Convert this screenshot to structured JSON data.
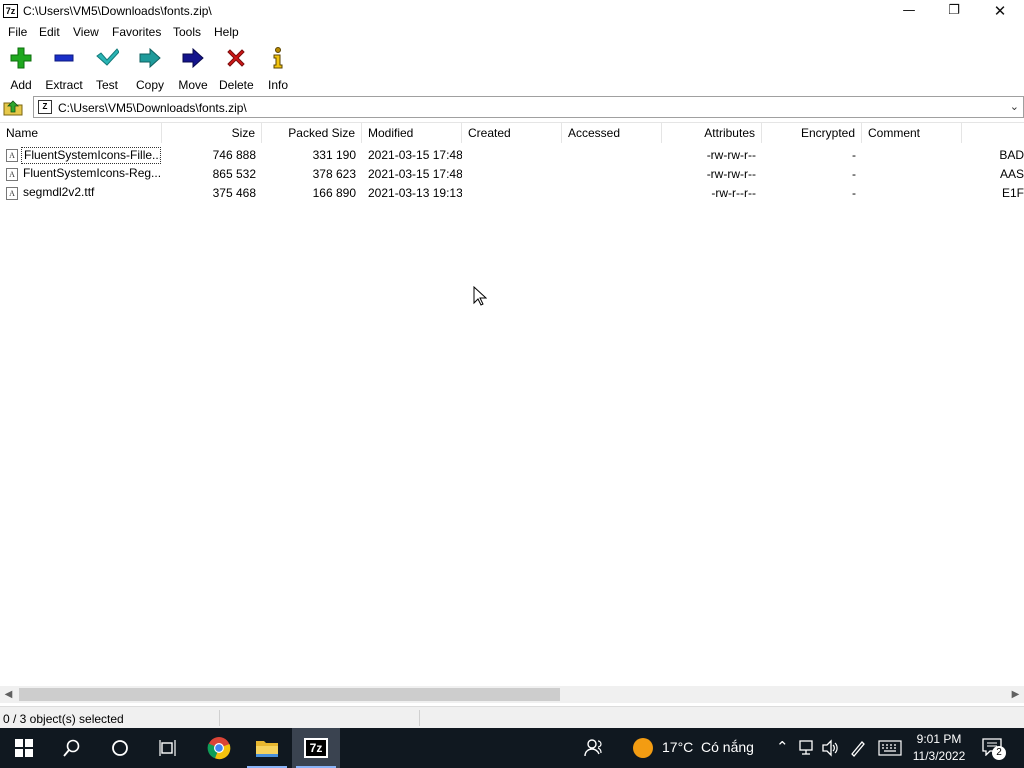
{
  "window": {
    "app_icon_text": "7z",
    "title": "C:\\Users\\VM5\\Downloads\\fonts.zip\\"
  },
  "menu": [
    "File",
    "Edit",
    "View",
    "Favorites",
    "Tools",
    "Help"
  ],
  "toolbar": {
    "add": "Add",
    "extract": "Extract",
    "test": "Test",
    "copy": "Copy",
    "move": "Move",
    "delete": "Delete",
    "info": "Info"
  },
  "address": {
    "icon_text": "Z",
    "path": "C:\\Users\\VM5\\Downloads\\fonts.zip\\"
  },
  "columns": {
    "name": "Name",
    "size": "Size",
    "packed": "Packed Size",
    "modified": "Modified",
    "created": "Created",
    "accessed": "Accessed",
    "attributes": "Attributes",
    "encrypted": "Encrypted",
    "comment": "Comment"
  },
  "files": [
    {
      "name": "FluentSystemIcons-Fille...",
      "size": "746 888",
      "packed": "331 190",
      "modified": "2021-03-15 17:48",
      "attributes": "-rw-rw-r--",
      "encrypted": "-",
      "crc": "BAD"
    },
    {
      "name": "FluentSystemIcons-Reg...",
      "size": "865 532",
      "packed": "378 623",
      "modified": "2021-03-15 17:48",
      "attributes": "-rw-rw-r--",
      "encrypted": "-",
      "crc": "AAS"
    },
    {
      "name": "segmdl2v2.ttf",
      "size": "375 468",
      "packed": "166 890",
      "modified": "2021-03-13 19:13",
      "attributes": "-rw-r--r--",
      "encrypted": "-",
      "crc": "E1F"
    }
  ],
  "status": {
    "selection": "0 / 3 object(s) selected"
  },
  "taskbar": {
    "weather_temp": "17°C",
    "weather_desc": "Có nắng",
    "time": "9:01 PM",
    "date": "11/3/2022",
    "notification_count": "2",
    "active_app_label": "7z"
  },
  "colors": {
    "add_green": "#1fa81f",
    "extract_blue": "#1a2fc8",
    "test_teal": "#2ab5b5",
    "copy_teal": "#1e9a9a",
    "move_navy": "#14148c",
    "delete_red": "#d01818",
    "taskbar_bg": "#101820",
    "weather_sun": "#f39c12"
  }
}
